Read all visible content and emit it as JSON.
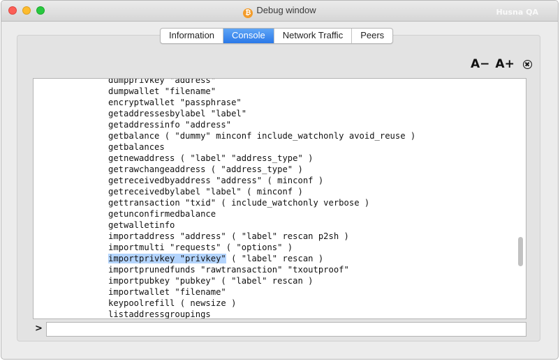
{
  "window": {
    "title": "Debug window",
    "watermark": "Husna QA"
  },
  "tabs": [
    {
      "label": "Information",
      "active": false
    },
    {
      "label": "Console",
      "active": true
    },
    {
      "label": "Network Traffic",
      "active": false
    },
    {
      "label": "Peers",
      "active": false
    }
  ],
  "toolbar": {
    "font_smaller": "A−",
    "font_larger": "A+",
    "clear_icon": "close-circle-icon"
  },
  "console": {
    "lines": [
      {
        "text": "dumpprivkey \"address\""
      },
      {
        "text": "dumpwallet \"filename\""
      },
      {
        "text": "encryptwallet \"passphrase\""
      },
      {
        "text": "getaddressesbylabel \"label\""
      },
      {
        "text": "getaddressinfo \"address\""
      },
      {
        "text": "getbalance ( \"dummy\" minconf include_watchonly avoid_reuse )"
      },
      {
        "text": "getbalances"
      },
      {
        "text": "getnewaddress ( \"label\" \"address_type\" )"
      },
      {
        "text": "getrawchangeaddress ( \"address_type\" )"
      },
      {
        "text": "getreceivedbyaddress \"address\" ( minconf )"
      },
      {
        "text": "getreceivedbylabel \"label\" ( minconf )"
      },
      {
        "text": "gettransaction \"txid\" ( include_watchonly verbose )"
      },
      {
        "text": "getunconfirmedbalance"
      },
      {
        "text": "getwalletinfo"
      },
      {
        "text": "importaddress \"address\" ( \"label\" rescan p2sh )"
      },
      {
        "text": "importmulti \"requests\" ( \"options\" )"
      },
      {
        "text": "importprivkey \"privkey\" ( \"label\" rescan )",
        "highlight": "importprivkey \"privkey\"",
        "rest": " ( \"label\" rescan )"
      },
      {
        "text": "importprunedfunds \"rawtransaction\" \"txoutproof\""
      },
      {
        "text": "importpubkey \"pubkey\" ( \"label\" rescan )"
      },
      {
        "text": "importwallet \"filename\""
      },
      {
        "text": "keypoolrefill ( newsize )"
      },
      {
        "text": "listaddressgroupings"
      }
    ],
    "prompt": ">",
    "input_value": ""
  },
  "colors": {
    "active_tab": "#2a79e8",
    "selection": "#b3d4fd"
  }
}
